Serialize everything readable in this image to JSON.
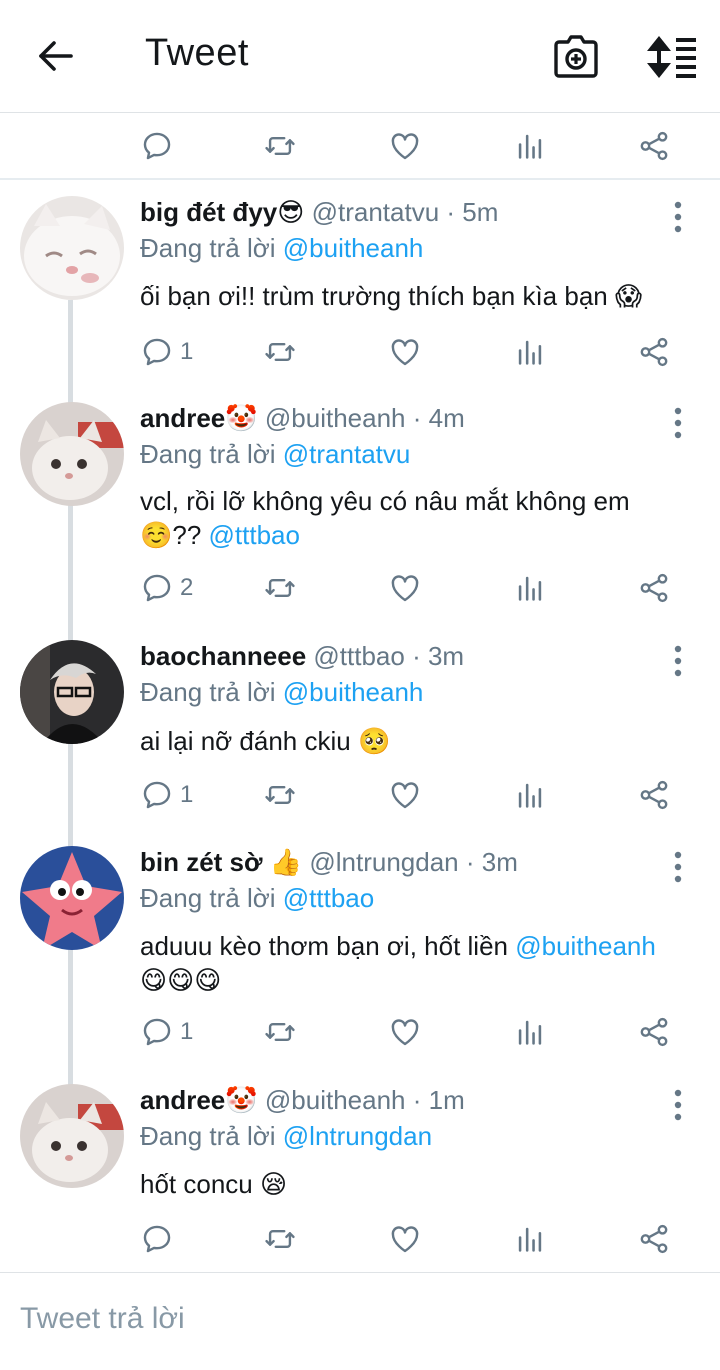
{
  "header": {
    "title": "Tweet"
  },
  "colors": {
    "link": "#1da1f2",
    "muted": "#657786",
    "divider": "#e6ecf0"
  },
  "top_actions": {
    "reply": "",
    "retweet": "",
    "like": "",
    "stats": "",
    "share": ""
  },
  "tweets": [
    {
      "name": "big đét đyy",
      "name_emoji": "😎",
      "handle": "@trantatvu",
      "time": "5m",
      "replying_prefix": "Đang trả lời ",
      "replying_to": "@buitheanh",
      "text": "ối bạn ơi!! trùm trường thích bạn kìa bạn",
      "text_emoji": "😱",
      "reply_count": "1"
    },
    {
      "name": "andree",
      "name_emoji": "🤡",
      "handle": "@buitheanh",
      "time": "4m",
      "replying_prefix": "Đang trả lời ",
      "replying_to": "@trantatvu",
      "text_line1": "vcl, rồi lỡ không yêu có nâu mắt không em",
      "text_line2_emoji": "☺️",
      "text_line2": "??",
      "mention": "@tttbao",
      "reply_count": "2"
    },
    {
      "name": "baochanneee",
      "handle": "@tttbao",
      "time": "3m",
      "replying_prefix": "Đang trả lời ",
      "replying_to": "@buitheanh",
      "text": "ai lại nỡ đánh ckiu",
      "text_emoji": "🥺",
      "reply_count": "1"
    },
    {
      "name": "bin zét sờ",
      "name_emoji": "👍",
      "handle": "@lntrungdan",
      "time": "3m",
      "replying_prefix": "Đang trả lời ",
      "replying_to": "@tttbao",
      "text": "aduuu kèo thơm bạn ơi, hốt liền",
      "mention": "@buitheanh",
      "text_emojis": "😋😋😋",
      "reply_count": "1"
    },
    {
      "name": "andree",
      "name_emoji": "🤡",
      "handle": "@buitheanh",
      "time": "1m",
      "replying_prefix": "Đang trả lời ",
      "replying_to": "@lntrungdan",
      "text": "hốt concu",
      "text_emoji": "😪",
      "reply_count": ""
    }
  ],
  "composer": {
    "placeholder": "Tweet trả lời"
  }
}
